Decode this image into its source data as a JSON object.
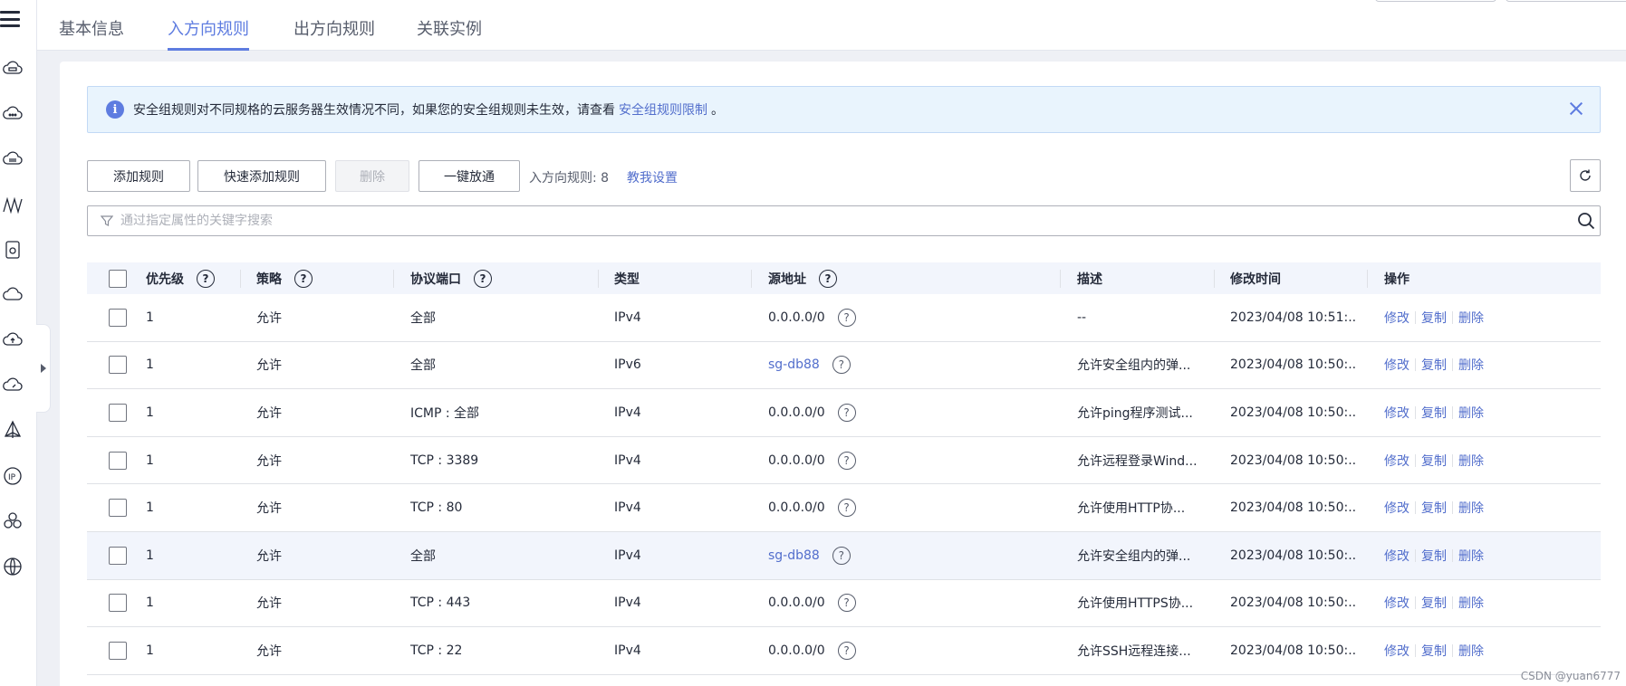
{
  "tabs": [
    {
      "label": "基本信息"
    },
    {
      "label": "入方向规则"
    },
    {
      "label": "出方向规则"
    },
    {
      "label": "关联实例"
    }
  ],
  "notice": {
    "text": "安全组规则对不同规格的云服务器生效情况不同，如果您的安全组规则未生效，请查看",
    "link": "安全组规则限制",
    "suffix": "。"
  },
  "toolbar": {
    "add_rule": "添加规则",
    "quick_add": "快速添加规则",
    "delete": "删除",
    "one_click": "一键放通",
    "count_label": "入方向规则: 8",
    "teach_link": "教我设置"
  },
  "search": {
    "placeholder": "通过指定属性的关键字搜索"
  },
  "table": {
    "headers": {
      "priority": "优先级",
      "policy": "策略",
      "protocol_port": "协议端口",
      "type": "类型",
      "source": "源地址",
      "description": "描述",
      "modified": "修改时间",
      "actions": "操作"
    },
    "rows": [
      {
        "priority": "1",
        "policy": "允许",
        "protocol_port": "全部",
        "type": "IPv4",
        "source": "0.0.0.0/0",
        "source_link": false,
        "description": "--",
        "modified": "2023/04/08 10:51:...",
        "edit": "修改",
        "copy": "复制",
        "del": "删除"
      },
      {
        "priority": "1",
        "policy": "允许",
        "protocol_port": "全部",
        "type": "IPv6",
        "source": "sg-db88",
        "source_link": true,
        "description": "允许安全组内的弹...",
        "modified": "2023/04/08 10:50:...",
        "edit": "修改",
        "copy": "复制",
        "del": "删除"
      },
      {
        "priority": "1",
        "policy": "允许",
        "protocol_port": "ICMP : 全部",
        "type": "IPv4",
        "source": "0.0.0.0/0",
        "source_link": false,
        "description": "允许ping程序测试...",
        "modified": "2023/04/08 10:50:...",
        "edit": "修改",
        "copy": "复制",
        "del": "删除"
      },
      {
        "priority": "1",
        "policy": "允许",
        "protocol_port": "TCP : 3389",
        "type": "IPv4",
        "source": "0.0.0.0/0",
        "source_link": false,
        "description": "允许远程登录Wind...",
        "modified": "2023/04/08 10:50:...",
        "edit": "修改",
        "copy": "复制",
        "del": "删除"
      },
      {
        "priority": "1",
        "policy": "允许",
        "protocol_port": "TCP : 80",
        "type": "IPv4",
        "source": "0.0.0.0/0",
        "source_link": false,
        "description": "允许使用HTTP协...",
        "modified": "2023/04/08 10:50:...",
        "edit": "修改",
        "copy": "复制",
        "del": "删除"
      },
      {
        "priority": "1",
        "policy": "允许",
        "protocol_port": "全部",
        "type": "IPv4",
        "source": "sg-db88",
        "source_link": true,
        "description": "允许安全组内的弹...",
        "modified": "2023/04/08 10:50:...",
        "edit": "修改",
        "copy": "复制",
        "del": "删除"
      },
      {
        "priority": "1",
        "policy": "允许",
        "protocol_port": "TCP : 443",
        "type": "IPv4",
        "source": "0.0.0.0/0",
        "source_link": false,
        "description": "允许使用HTTPS协...",
        "modified": "2023/04/08 10:50:...",
        "edit": "修改",
        "copy": "复制",
        "del": "删除"
      },
      {
        "priority": "1",
        "policy": "允许",
        "protocol_port": "TCP : 22",
        "type": "IPv4",
        "source": "0.0.0.0/0",
        "source_link": false,
        "description": "允许SSH远程连接...",
        "modified": "2023/04/08 10:50:...",
        "edit": "修改",
        "copy": "复制",
        "del": "删除"
      }
    ]
  },
  "sidebar_icons": [
    "cloud-server-icon",
    "cloud-more-icon",
    "cloud-storage-icon",
    "network-wave-icon",
    "disk-icon",
    "cloud-icon",
    "cloud-upload-icon",
    "cloud-speed-icon",
    "vpn-icon",
    "ip-icon",
    "cluster-icon",
    "globe-icon"
  ],
  "watermark": "CSDN @yuan6777",
  "colors": {
    "accent": "#5e7ce0",
    "link": "#526ecc",
    "notice_bg": "#e9f4fd",
    "header_bg": "#f2f5fc"
  }
}
